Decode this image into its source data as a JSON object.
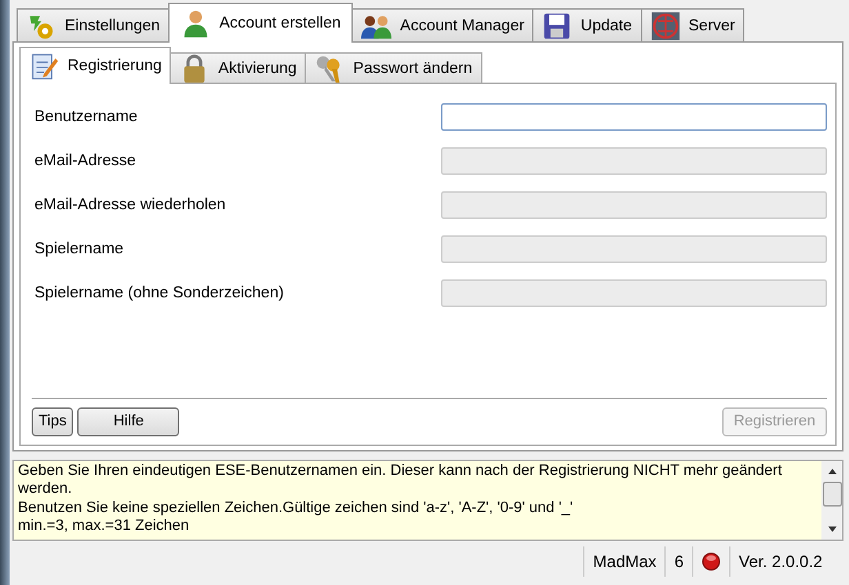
{
  "tabs": [
    {
      "label": "Einstellungen",
      "selected": false
    },
    {
      "label": "Account erstellen",
      "selected": true
    },
    {
      "label": "Account Manager",
      "selected": false
    },
    {
      "label": "Update",
      "selected": false
    },
    {
      "label": "Server",
      "selected": false
    }
  ],
  "subtabs": [
    {
      "label": "Registrierung",
      "selected": true
    },
    {
      "label": "Aktivierung",
      "selected": false
    },
    {
      "label": "Passwort ändern",
      "selected": false
    }
  ],
  "fields": [
    {
      "label": "Benutzername",
      "disabled": false
    },
    {
      "label": "eMail-Adresse",
      "disabled": true
    },
    {
      "label": "eMail-Adresse wiederholen",
      "disabled": true
    },
    {
      "label": "Spielername",
      "disabled": true
    },
    {
      "label": "Spielername (ohne Sonderzeichen)",
      "disabled": true
    }
  ],
  "buttons": [
    {
      "label": "Tips",
      "disabled": false
    },
    {
      "label": "Hilfe",
      "disabled": false
    }
  ],
  "submit": {
    "label": "Registrieren",
    "disabled": true
  },
  "info_lines": [
    "Geben Sie Ihren eindeutigen ESE-Benutzernamen ein. Dieser kann nach der Registrierung NICHT mehr geändert werden.",
    "Benutzen Sie keine speziellen Zeichen.Gültige zeichen sind 'a-z', 'A-Z', '0-9' und '_'",
    "min.=3, max.=31 Zeichen"
  ],
  "status_bar": {
    "user": "MadMax",
    "count": "6",
    "version": "Ver. 2.0.0.2"
  }
}
